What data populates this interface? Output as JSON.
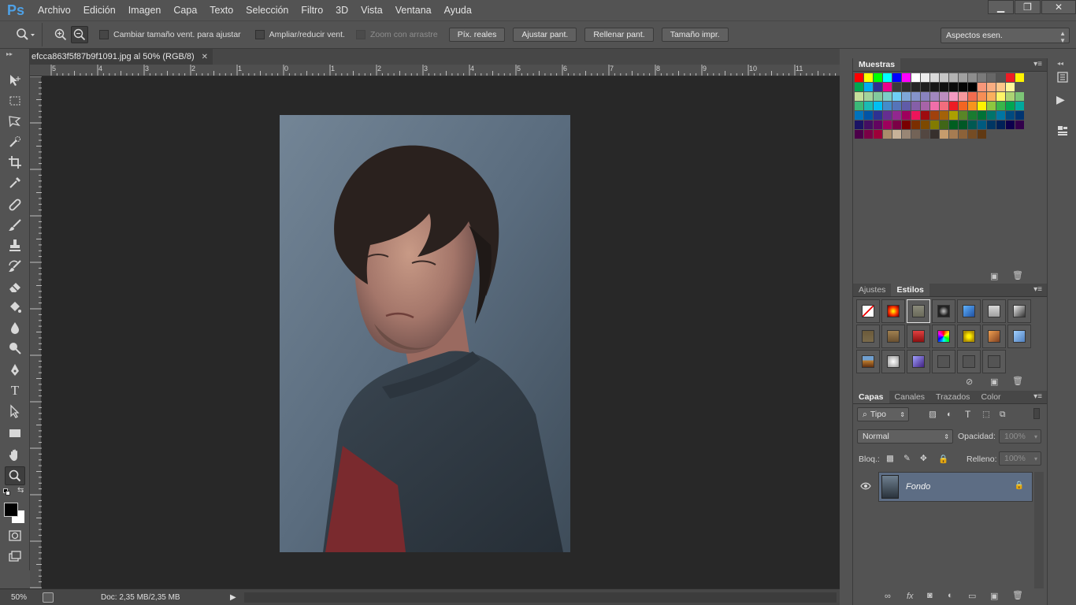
{
  "app": {
    "logo": "Ps"
  },
  "menu": [
    "Archivo",
    "Edición",
    "Imagen",
    "Capa",
    "Texto",
    "Selección",
    "Filtro",
    "3D",
    "Vista",
    "Ventana",
    "Ayuda"
  ],
  "window_controls": {
    "minimize": "▁",
    "restore": "❐",
    "close": "✕"
  },
  "options": {
    "resize_windows": "Cambiar tamaño vent. para ajustar",
    "zoom_all": "Ampliar/reducir vent.",
    "scrubby_zoom": "Zoom con arrastre",
    "actual_pixels": "Píx. reales",
    "fit_screen": "Ajustar pant.",
    "fill_screen": "Rellenar pant.",
    "print_size": "Tamaño impr.",
    "workspace": "Aspectos esen."
  },
  "document": {
    "tab_title": "efcca863f5f87b9f1091.jpg al 50% (RGB/8)",
    "close": "✕"
  },
  "ruler": {
    "h_labels": [
      "5",
      "4",
      "3",
      "2",
      "1",
      "0",
      "1",
      "2",
      "3",
      "4",
      "5",
      "6",
      "7",
      "8",
      "9",
      "10",
      "11"
    ]
  },
  "status": {
    "zoom": "50%",
    "doc_info": "Doc: 2,35 MB/2,35 MB"
  },
  "panels": {
    "swatches": {
      "tab": "Muestras"
    },
    "adjust_styles": {
      "tab_adjust": "Ajustes",
      "tab_styles": "Estilos"
    },
    "layers": {
      "tabs": [
        "Capas",
        "Canales",
        "Trazados",
        "Color"
      ],
      "filter_kind": "Tipo",
      "blend_mode": "Normal",
      "opacity_label": "Opacidad:",
      "opacity_value": "100%",
      "lock_label": "Bloq.:",
      "fill_label": "Relleno:",
      "fill_value": "100%",
      "layer_name": "Fondo"
    }
  },
  "colors": {
    "accent_blue": "#4ea1e6",
    "selected_layer": "#5d6d84",
    "foreground": "#000000",
    "background": "#ffffff"
  }
}
